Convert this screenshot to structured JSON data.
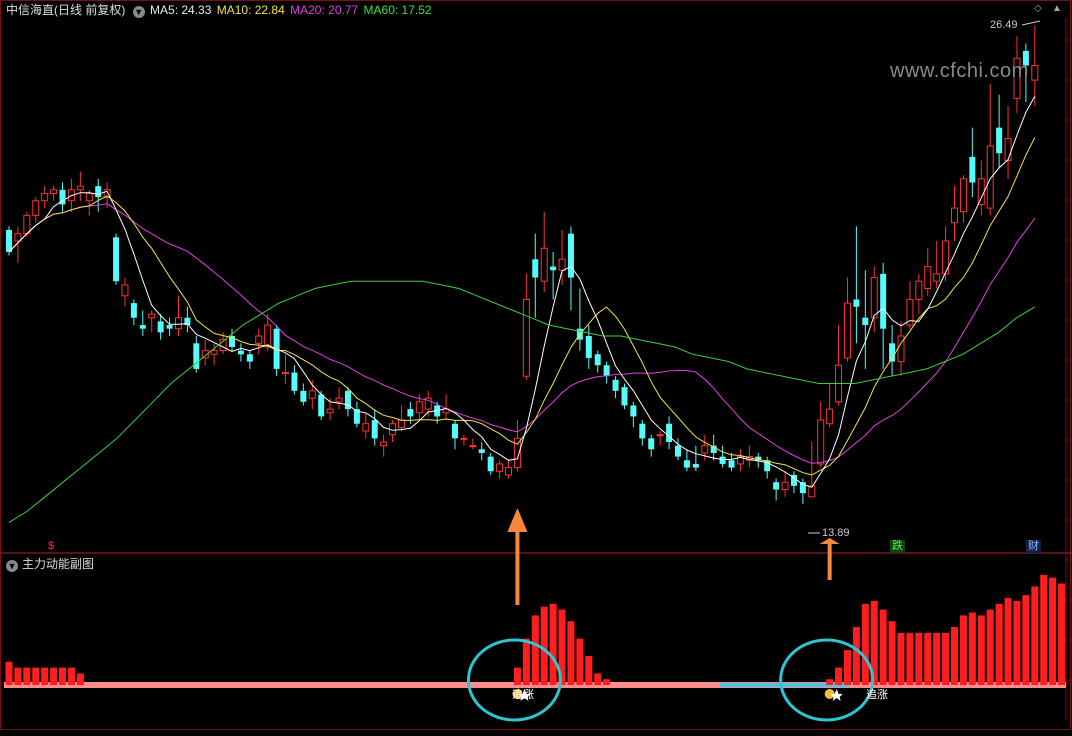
{
  "header": {
    "symbol": "中信海直(日线 前复权)",
    "ma_labels": [
      {
        "text": "MA5: 24.33",
        "color": "#e8e8e8"
      },
      {
        "text": "MA10: 22.84",
        "color": "#f2e34a"
      },
      {
        "text": "MA20: 20.77",
        "color": "#e040e0"
      },
      {
        "text": "MA60: 17.52",
        "color": "#40e040"
      }
    ]
  },
  "watermark": "www.cfchi.com",
  "annotations": {
    "high_label": "26.49",
    "low_label": "13.89",
    "badge_die": "跌",
    "badge_cai": "财",
    "signal_label": "追涨",
    "dollar_marker": "$"
  },
  "sub_panel": {
    "title": "主力动能副图"
  },
  "colors": {
    "up": "#ff3232",
    "down": "#54fcfc",
    "ma5": "#ffffff",
    "ma10": "#f2e34a",
    "ma20": "#e040e0",
    "ma60": "#3ccf3c",
    "divider": "#b22222",
    "arrow": "#f5883a",
    "circle": "#2ec4d0",
    "energy_bar": "#ff1e1e",
    "energy_base": "#ff8c8c",
    "energy_base_alt": "#3cc8e8"
  },
  "chart_data": {
    "type": "candlestick",
    "price_range": [
      12.8,
      27.3
    ],
    "main_series": "中信海直(日线 前复权)",
    "candles": [
      [
        21.5,
        20.9,
        21.6,
        20.8
      ],
      [
        21.2,
        21.4,
        21.6,
        20.6
      ],
      [
        21.4,
        21.9,
        22.0,
        21.3
      ],
      [
        21.9,
        22.3,
        22.4,
        21.7
      ],
      [
        22.3,
        22.5,
        22.7,
        22.1
      ],
      [
        22.5,
        22.6,
        22.7,
        22.3
      ],
      [
        22.6,
        22.2,
        22.8,
        22.0
      ],
      [
        22.3,
        22.6,
        22.9,
        22.0
      ],
      [
        22.6,
        22.7,
        23.1,
        22.3
      ],
      [
        22.3,
        22.5,
        22.6,
        21.9
      ],
      [
        22.7,
        22.4,
        22.9,
        22.0
      ],
      [
        22.4,
        22.6,
        22.8,
        22.1
      ],
      [
        21.3,
        20.1,
        21.4,
        20.0
      ],
      [
        19.7,
        20.0,
        20.2,
        19.4
      ],
      [
        19.5,
        19.1,
        19.6,
        18.9
      ],
      [
        18.9,
        18.8,
        19.3,
        18.6
      ],
      [
        19.1,
        19.2,
        19.3,
        18.7
      ],
      [
        19.0,
        18.7,
        19.2,
        18.5
      ],
      [
        18.9,
        18.8,
        19.1,
        18.6
      ],
      [
        18.8,
        19.1,
        19.7,
        18.6
      ],
      [
        19.1,
        18.9,
        19.4,
        18.7
      ],
      [
        18.4,
        17.7,
        18.6,
        17.6
      ],
      [
        18.0,
        18.2,
        18.5,
        17.8
      ],
      [
        18.1,
        18.2,
        18.4,
        17.8
      ],
      [
        18.2,
        18.5,
        18.7,
        18.1
      ],
      [
        18.6,
        18.3,
        18.8,
        18.2
      ],
      [
        18.2,
        18.1,
        18.4,
        17.9
      ],
      [
        18.1,
        17.9,
        18.2,
        17.7
      ],
      [
        18.4,
        18.6,
        18.8,
        18.1
      ],
      [
        18.3,
        18.9,
        19.2,
        18.2
      ],
      [
        18.8,
        17.7,
        18.9,
        17.5
      ],
      [
        17.6,
        17.6,
        18.1,
        17.3
      ],
      [
        17.6,
        17.1,
        17.8,
        17.0
      ],
      [
        17.1,
        16.8,
        17.3,
        16.7
      ],
      [
        16.9,
        17.1,
        17.4,
        16.6
      ],
      [
        17.0,
        16.4,
        17.1,
        16.3
      ],
      [
        16.5,
        16.6,
        16.9,
        16.3
      ],
      [
        16.8,
        16.9,
        17.2,
        16.6
      ],
      [
        17.1,
        16.6,
        17.2,
        16.4
      ],
      [
        16.6,
        16.2,
        16.8,
        16.1
      ],
      [
        16.0,
        16.2,
        16.5,
        15.8
      ],
      [
        16.3,
        15.8,
        16.6,
        15.6
      ],
      [
        15.6,
        15.7,
        15.9,
        15.3
      ],
      [
        15.9,
        16.2,
        16.3,
        15.7
      ],
      [
        16.1,
        16.3,
        16.7,
        16.0
      ],
      [
        16.6,
        16.4,
        16.8,
        16.2
      ],
      [
        16.5,
        16.8,
        17.0,
        16.3
      ],
      [
        16.6,
        16.9,
        17.1,
        16.4
      ],
      [
        16.7,
        16.4,
        16.8,
        16.2
      ],
      [
        16.5,
        16.6,
        17.0,
        16.3
      ],
      [
        16.2,
        15.8,
        16.3,
        15.5
      ],
      [
        15.8,
        15.8,
        15.9,
        15.6
      ],
      [
        15.6,
        15.6,
        15.8,
        15.5
      ],
      [
        15.5,
        15.4,
        15.7,
        15.2
      ],
      [
        15.3,
        14.9,
        15.4,
        14.8
      ],
      [
        14.9,
        15.1,
        15.2,
        14.7
      ],
      [
        14.8,
        15.0,
        15.2,
        14.7
      ],
      [
        15.0,
        15.8,
        16.3,
        14.9
      ],
      [
        17.5,
        19.6,
        20.3,
        17.4
      ],
      [
        20.7,
        20.2,
        21.4,
        19.1
      ],
      [
        20.1,
        21.0,
        22.0,
        19.8
      ],
      [
        20.5,
        20.4,
        20.9,
        19.6
      ],
      [
        20.4,
        20.7,
        21.5,
        20.0
      ],
      [
        21.4,
        20.2,
        21.6,
        19.3
      ],
      [
        18.8,
        18.5,
        19.9,
        18.2
      ],
      [
        18.6,
        18.0,
        18.9,
        17.7
      ],
      [
        18.1,
        17.8,
        18.2,
        17.6
      ],
      [
        17.8,
        17.5,
        17.9,
        17.3
      ],
      [
        17.4,
        17.1,
        17.5,
        16.9
      ],
      [
        17.2,
        16.7,
        17.3,
        16.6
      ],
      [
        16.7,
        16.4,
        16.8,
        16.1
      ],
      [
        16.2,
        15.8,
        16.3,
        15.6
      ],
      [
        15.8,
        15.5,
        15.9,
        15.3
      ],
      [
        15.9,
        15.9,
        16.0,
        15.6
      ],
      [
        16.2,
        15.7,
        16.4,
        15.5
      ],
      [
        15.6,
        15.3,
        15.8,
        15.2
      ],
      [
        15.2,
        15.0,
        15.5,
        14.9
      ],
      [
        15.1,
        15.0,
        15.6,
        14.9
      ],
      [
        15.4,
        15.6,
        15.9,
        15.2
      ],
      [
        15.6,
        15.4,
        15.9,
        15.2
      ],
      [
        15.3,
        15.1,
        15.6,
        15.0
      ],
      [
        15.2,
        15.0,
        15.4,
        14.9
      ],
      [
        15.1,
        15.3,
        15.5,
        14.9
      ],
      [
        15.2,
        15.3,
        15.6,
        15.0
      ],
      [
        15.3,
        15.2,
        15.4,
        15.0
      ],
      [
        15.2,
        14.9,
        15.3,
        14.7
      ],
      [
        14.6,
        14.4,
        14.7,
        14.1
      ],
      [
        14.4,
        14.6,
        14.9,
        14.2
      ],
      [
        14.8,
        14.5,
        14.9,
        14.3
      ],
      [
        14.6,
        14.3,
        14.7,
        14.0
      ],
      [
        14.2,
        14.5,
        15.7,
        14.2
      ],
      [
        15.1,
        16.3,
        16.8,
        15.0
      ],
      [
        16.2,
        16.6,
        17.3,
        16.1
      ],
      [
        16.8,
        17.8,
        18.9,
        16.7
      ],
      [
        18.0,
        19.5,
        20.2,
        17.9
      ],
      [
        19.6,
        19.4,
        21.6,
        18.4
      ],
      [
        19.1,
        18.9,
        20.4,
        17.7
      ],
      [
        19.1,
        20.2,
        20.5,
        18.7
      ],
      [
        20.3,
        18.8,
        20.6,
        17.7
      ],
      [
        18.4,
        17.9,
        18.9,
        17.5
      ],
      [
        17.9,
        18.6,
        19.0,
        17.5
      ],
      [
        18.9,
        19.6,
        20.1,
        18.8
      ],
      [
        19.6,
        20.1,
        20.3,
        19.2
      ],
      [
        19.9,
        20.5,
        21.0,
        19.7
      ],
      [
        20.1,
        20.3,
        21.2,
        19.9
      ],
      [
        20.3,
        21.2,
        21.6,
        20.1
      ],
      [
        21.7,
        22.1,
        22.7,
        21.2
      ],
      [
        22.0,
        22.9,
        23.0,
        21.7
      ],
      [
        23.5,
        22.8,
        24.3,
        22.4
      ],
      [
        22.2,
        22.9,
        23.4,
        21.9
      ],
      [
        22.1,
        23.8,
        25.5,
        21.9
      ],
      [
        24.3,
        23.6,
        25.2,
        23.2
      ],
      [
        23.4,
        24.0,
        24.9,
        22.9
      ],
      [
        25.1,
        26.2,
        26.8,
        24.7
      ],
      [
        26.4,
        26.0,
        26.6,
        25.0
      ],
      [
        25.6,
        26.0,
        27.1,
        24.9
      ]
    ],
    "ma_series": [
      {
        "name": "MA5",
        "value": 24.33
      },
      {
        "name": "MA10",
        "value": 22.84
      },
      {
        "name": "MA20",
        "value": 20.77
      },
      {
        "name": "MA60",
        "value": 17.52
      }
    ],
    "ma60": [
      13.5,
      13.8,
      14.2,
      14.6,
      15.0,
      15.4,
      15.8,
      16.3,
      16.8,
      17.3,
      17.7,
      18.1,
      18.5,
      18.9,
      19.2,
      19.5,
      19.7,
      19.9,
      20.0,
      20.1,
      20.1,
      20.1,
      20.1,
      20.1,
      20.0,
      19.9,
      19.7,
      19.5,
      19.3,
      19.1,
      18.9,
      18.8,
      18.7,
      18.6,
      18.6,
      18.5,
      18.4,
      18.3,
      18.1,
      18.0,
      17.9,
      17.7,
      17.6,
      17.5,
      17.4,
      17.3,
      17.3,
      17.3,
      17.4,
      17.5,
      17.6,
      17.7,
      17.9,
      18.1,
      18.4,
      18.7,
      19.1,
      19.4
    ],
    "energy": {
      "type": "bar",
      "values": [
        0.4,
        0.3,
        0.3,
        0.3,
        0.3,
        0.3,
        0.3,
        0.3,
        0.2,
        0,
        0,
        0,
        0,
        0,
        0,
        0,
        0,
        0,
        0,
        0,
        0,
        0,
        0,
        0,
        0,
        0,
        0,
        0,
        0,
        0,
        0,
        0,
        0,
        0,
        0,
        0,
        0,
        0,
        0,
        0,
        0,
        0,
        0,
        0,
        0,
        0,
        0,
        0,
        0,
        0,
        0,
        0,
        0,
        0,
        0,
        0,
        0,
        0.3,
        0.8,
        1.2,
        1.35,
        1.4,
        1.3,
        1.1,
        0.8,
        0.5,
        0.2,
        0.1,
        0,
        0,
        0,
        0,
        0,
        0,
        0,
        0,
        0,
        0,
        0,
        0,
        0,
        0,
        0,
        0,
        0,
        0,
        0,
        0,
        0,
        0,
        0,
        0,
        0.1,
        0.3,
        0.6,
        1.0,
        1.4,
        1.45,
        1.3,
        1.1,
        0.9,
        0.9,
        0.9,
        0.9,
        0.9,
        0.9,
        1.0,
        1.2,
        1.25,
        1.2,
        1.3,
        1.4,
        1.5,
        1.45,
        1.55,
        1.7,
        1.9,
        1.85,
        1.75
      ]
    },
    "signals": [
      57,
      92
    ]
  }
}
